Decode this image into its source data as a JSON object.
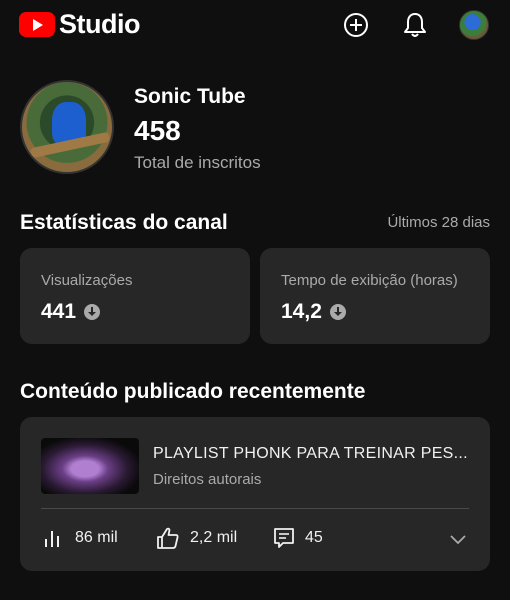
{
  "header": {
    "logo_text": "Studio",
    "icons": [
      "create-icon",
      "notifications-icon",
      "account-avatar"
    ]
  },
  "profile": {
    "channel_name": "Sonic Tube",
    "subscriber_count": "458",
    "subscriber_label": "Total de inscritos"
  },
  "stats": {
    "title": "Estatísticas do canal",
    "period": "Últimos 28 dias",
    "cards": [
      {
        "label": "Visualizações",
        "value": "441",
        "trend": "down"
      },
      {
        "label": "Tempo de exibição (horas)",
        "value": "14,2",
        "trend": "down"
      }
    ]
  },
  "recent": {
    "title": "Conteúdo publicado recentemente",
    "video": {
      "title": "PLAYLIST PHONK PARA TREINAR PES...",
      "status": "Direitos autorais",
      "views": "86 mil",
      "likes": "2,2 mil",
      "comments": "45"
    }
  },
  "colors": {
    "background": "#0f0f0f",
    "card": "#272727",
    "brand_red": "#ff0000",
    "secondary_text": "#aaaaaa"
  }
}
